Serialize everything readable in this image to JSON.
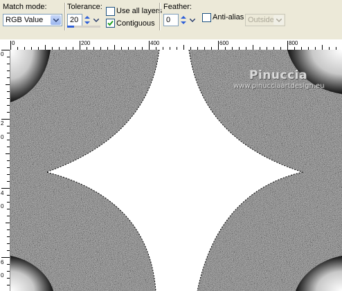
{
  "toolbar": {
    "match_mode": {
      "label": "Match mode:",
      "value": "RGB Value"
    },
    "tolerance": {
      "label": "Tolerance:",
      "value": "20",
      "level_percent": 20
    },
    "use_all_layers": {
      "label": "Use all layers",
      "checked": false
    },
    "contiguous": {
      "label": "Contiguous",
      "checked": true
    },
    "feather": {
      "label": "Feather:",
      "value": "0"
    },
    "anti_alias": {
      "label": "Anti-alias",
      "checked": false
    },
    "alias_mode": {
      "value": "Outside",
      "enabled": false
    }
  },
  "rulers": {
    "top": [
      "0",
      "200",
      "400",
      "600",
      "800"
    ],
    "left": [
      "0",
      "2",
      "0",
      "4",
      "0",
      "6",
      "0"
    ]
  },
  "watermark": {
    "name": "Pinuccia",
    "url": "www.pinucciaartdesign.eu"
  },
  "colors": {
    "accent": "#2e5fd8",
    "panel": "#ece9d8",
    "selection": "#ffffff"
  }
}
